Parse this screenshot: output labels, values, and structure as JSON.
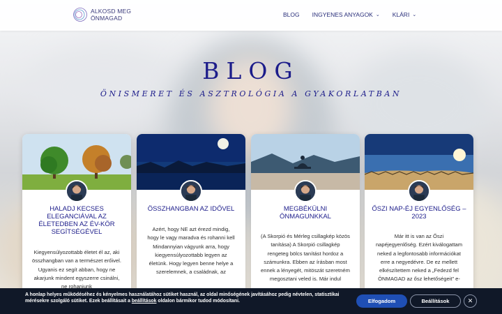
{
  "header": {
    "logo_line1": "ALKOSD MEG",
    "logo_line2": "ÖNMAGAD",
    "nav": [
      {
        "label": "BLOG",
        "dropdown": false
      },
      {
        "label": "INGYENES ANYAGOK",
        "dropdown": true
      },
      {
        "label": "KLÁRI",
        "dropdown": true
      }
    ]
  },
  "hero": {
    "title": "BLOG",
    "subtitle": "ÖNISMERET ÉS ASZTROLÓGIA A GYAKORLATBAN"
  },
  "cards": [
    {
      "title": "HALADJ KECSES ELEGANCIÁVAL AZ ÉLETEDBEN AZ ÉV-KÖR SEGÍTSÉGÉVEL",
      "text": "Kiegyensúlyozottabb életet él az, aki összhangban van a természet erőivel. Ugyanis ez segít abban, hogy ne akarjunk mindent egyszerre csinálni, ne rohanjunk"
    },
    {
      "title": "ÖSSZHANGBAN AZ IDŐVEL",
      "text": "Azért, hogy NE azt érezd mindig, hogy le vagy maradva és rohanni kell Mindannyian vágyunk arra, hogy kiegyensúlyozottabb legyen az életünk. Hogy legyen benne helye a szerelemnek, a családnak, az"
    },
    {
      "title": "MEGBÉKÜLNI ÖNMAGUNKKAL",
      "text": "(A Skorpió és Mérleg csillagkép közös tanítása) A Skorpió csillagkép rengeteg bölcs tanítást hordoz a számunkra. Ebben az írásban most ennek a lényegét, mitöszát szeretném megosztani veled is. Már indul"
    },
    {
      "title": "ŐSZI NAP-ÉJ EGYENLŐSÉG – 2023",
      "text": "Már itt is van az Őszi napéjegyenlőség. Ezért kiválogattam neked a legfontosabb információkat erre a negyedévre. De ez mellett elkészítettem neked a „Fedezd fel ÖNMAGAD az ősz lehetőségeit” e-"
    }
  ],
  "cookie": {
    "text_before_link": "A honlap helyes működéséhez és kényelmes használatához sütiket használ, az oldal minőségének javításához pedig névtelen, statisztikai mérésekre szolgáló sütiket. Ezek beállításait a ",
    "link": "beállítások",
    "text_after_link": " oldalon bármikor tudod módosítani.",
    "accept_label": "Elfogadom",
    "settings_label": "Beállítások",
    "close_symbol": "✕"
  },
  "colors": {
    "brand": "#1c1c8a",
    "cookie_bg": "#101828",
    "accept_btn": "#1f4fb5"
  }
}
